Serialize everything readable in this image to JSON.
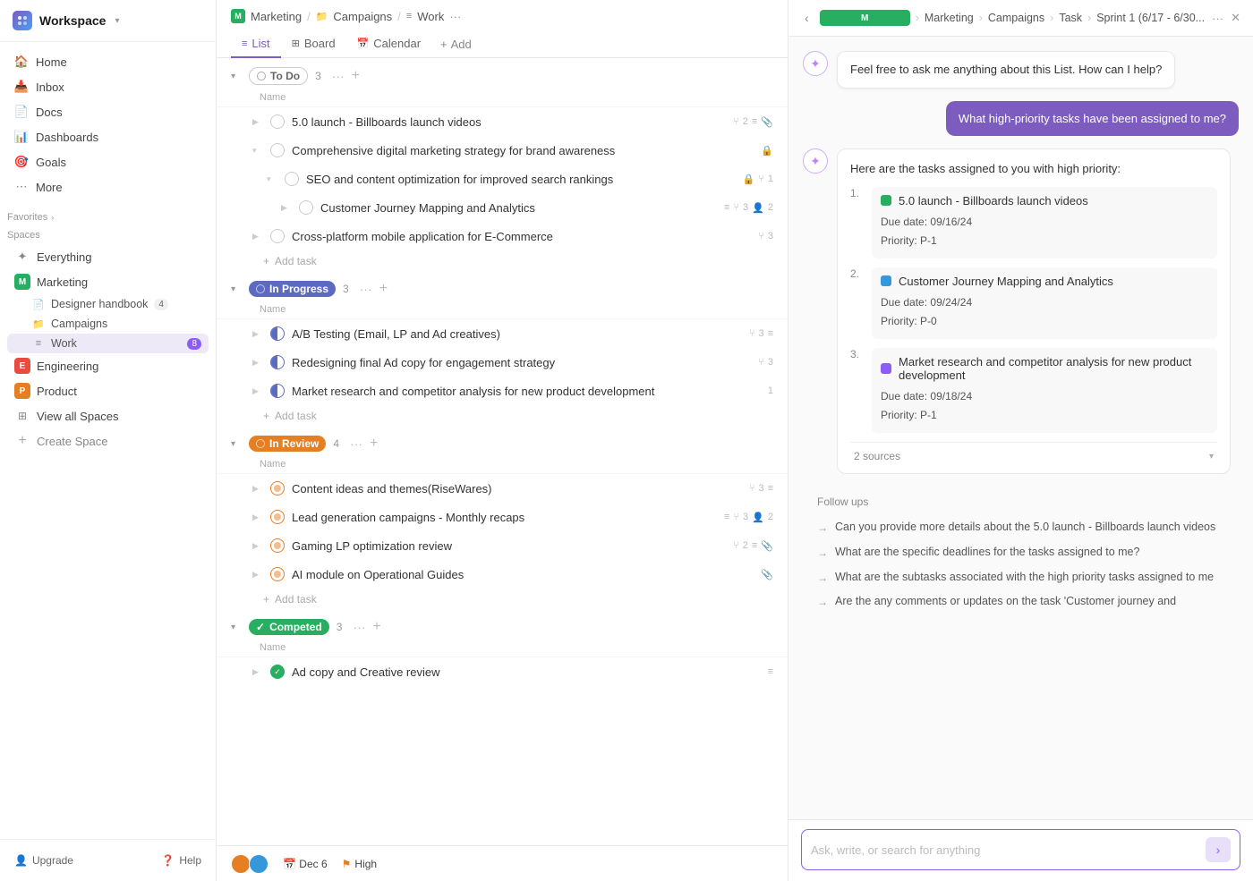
{
  "workspace": {
    "name": "Workspace",
    "logo_text": "W"
  },
  "sidebar": {
    "nav_items": [
      {
        "id": "home",
        "label": "Home",
        "icon": "🏠"
      },
      {
        "id": "inbox",
        "label": "Inbox",
        "icon": "📥"
      },
      {
        "id": "docs",
        "label": "Docs",
        "icon": "📄"
      },
      {
        "id": "dashboards",
        "label": "Dashboards",
        "icon": "📊"
      },
      {
        "id": "goals",
        "label": "Goals",
        "icon": "🎯"
      },
      {
        "id": "more",
        "label": "More",
        "icon": "⋯"
      }
    ],
    "favorites_label": "Favorites",
    "spaces_label": "Spaces",
    "everything_label": "Everything",
    "marketing_label": "Marketing",
    "designer_handbook_label": "Designer handbook",
    "designer_handbook_count": "4",
    "campaigns_label": "Campaigns",
    "work_label": "Work",
    "work_count": "8",
    "engineering_label": "Engineering",
    "product_label": "Product",
    "view_all_spaces_label": "View all Spaces",
    "create_space_label": "Create Space",
    "upgrade_label": "Upgrade",
    "help_label": "Help"
  },
  "main": {
    "breadcrumb": {
      "marketing": "Marketing",
      "campaigns": "Campaigns",
      "work": "Work"
    },
    "tabs": [
      {
        "id": "list",
        "label": "List",
        "active": true
      },
      {
        "id": "board",
        "label": "Board",
        "active": false
      },
      {
        "id": "calendar",
        "label": "Calendar",
        "active": false
      }
    ],
    "add_tab_label": "Add",
    "col_header_name": "Name",
    "sections": [
      {
        "id": "todo",
        "label": "To Do",
        "count": "3",
        "type": "todo",
        "tasks": [
          {
            "id": "t1",
            "name": "5.0 launch - Billboards launch videos",
            "meta": "2",
            "has_attachment": true,
            "indent": 0
          },
          {
            "id": "t2",
            "name": "Comprehensive digital marketing strategy for brand awareness",
            "has_lock": true,
            "indent": 0,
            "expanded": true
          },
          {
            "id": "t3",
            "name": "SEO and content optimization for improved search rankings",
            "has_lock": true,
            "meta": "1",
            "indent": 1
          },
          {
            "id": "t4",
            "name": "Customer Journey Mapping and Analytics",
            "meta": "3",
            "meta2": "2",
            "indent": 2
          },
          {
            "id": "t5",
            "name": "Cross-platform mobile application for E-Commerce",
            "meta": "3",
            "indent": 0
          }
        ],
        "add_task_label": "Add task"
      },
      {
        "id": "in-progress",
        "label": "In Progress",
        "count": "3",
        "type": "in-progress",
        "tasks": [
          {
            "id": "p1",
            "name": "A/B Testing (Email, LP and Ad creatives)",
            "meta": "3",
            "indent": 0
          },
          {
            "id": "p2",
            "name": "Redesigning final Ad copy for engagement strategy",
            "meta": "3",
            "indent": 0
          },
          {
            "id": "p3",
            "name": "Market research and competitor analysis for new product development",
            "meta": "1",
            "indent": 0
          }
        ],
        "add_task_label": "Add task"
      },
      {
        "id": "in-review",
        "label": "In Review",
        "count": "4",
        "type": "in-review",
        "tasks": [
          {
            "id": "r1",
            "name": "Content ideas and themes(RiseWares)",
            "meta": "3",
            "indent": 0
          },
          {
            "id": "r2",
            "name": "Lead generation campaigns - Monthly recaps",
            "meta": "3",
            "meta2": "2",
            "indent": 0
          },
          {
            "id": "r3",
            "name": "Gaming LP optimization review",
            "meta": "2",
            "has_attachment": true,
            "indent": 0
          },
          {
            "id": "r4",
            "name": "AI module on Operational Guides",
            "has_attachment": true,
            "indent": 0
          }
        ],
        "add_task_label": "Add task"
      },
      {
        "id": "completed",
        "label": "Competed",
        "count": "3",
        "type": "completed",
        "tasks": [
          {
            "id": "c1",
            "name": "Ad copy and Creative review",
            "indent": 0
          }
        ],
        "add_task_label": "Add task"
      }
    ]
  },
  "ai_panel": {
    "breadcrumb": {
      "marketing": "Marketing",
      "campaigns": "Campaigns",
      "task": "Task",
      "sprint": "Sprint 1 (6/17 - 6/30..."
    },
    "initial_message": "Feel free to ask me anything about this List. How can I help?",
    "user_message": "What high-priority tasks have been assigned to me?",
    "response_intro": "Here are the tasks assigned to you with high priority:",
    "tasks": [
      {
        "num": "1.",
        "name": "5.0 launch - Billboards launch videos",
        "dot_color": "#27ae60",
        "due_date_label": "Due date:",
        "due_date": "09/16/24",
        "priority_label": "Priority:",
        "priority": "P-1"
      },
      {
        "num": "2.",
        "name": "Customer Journey Mapping and Analytics",
        "dot_color": "#3498db",
        "due_date_label": "Due date:",
        "due_date": "09/24/24",
        "priority_label": "Priority:",
        "priority": "P-0"
      },
      {
        "num": "3.",
        "name": "Market research and competitor analysis for new product development",
        "dot_color": "#8b5cf6",
        "due_date_label": "Due date:",
        "due_date": "09/18/24",
        "priority_label": "Priority:",
        "priority": "P-1"
      }
    ],
    "sources_label": "2 sources",
    "followups_label": "Follow ups",
    "followups": [
      "Can you provide more details about the 5.0 launch - Billboards launch videos",
      "What are the specific deadlines for the tasks assigned to me?",
      "What are the subtasks associated with the high priority tasks assigned to me",
      "Are the any comments or updates on the task 'Customer journey and"
    ],
    "input_placeholder": "Ask, write, or search for anything"
  },
  "bottom_bar": {
    "due_date_label": "Dec 6",
    "priority_label": "High"
  }
}
